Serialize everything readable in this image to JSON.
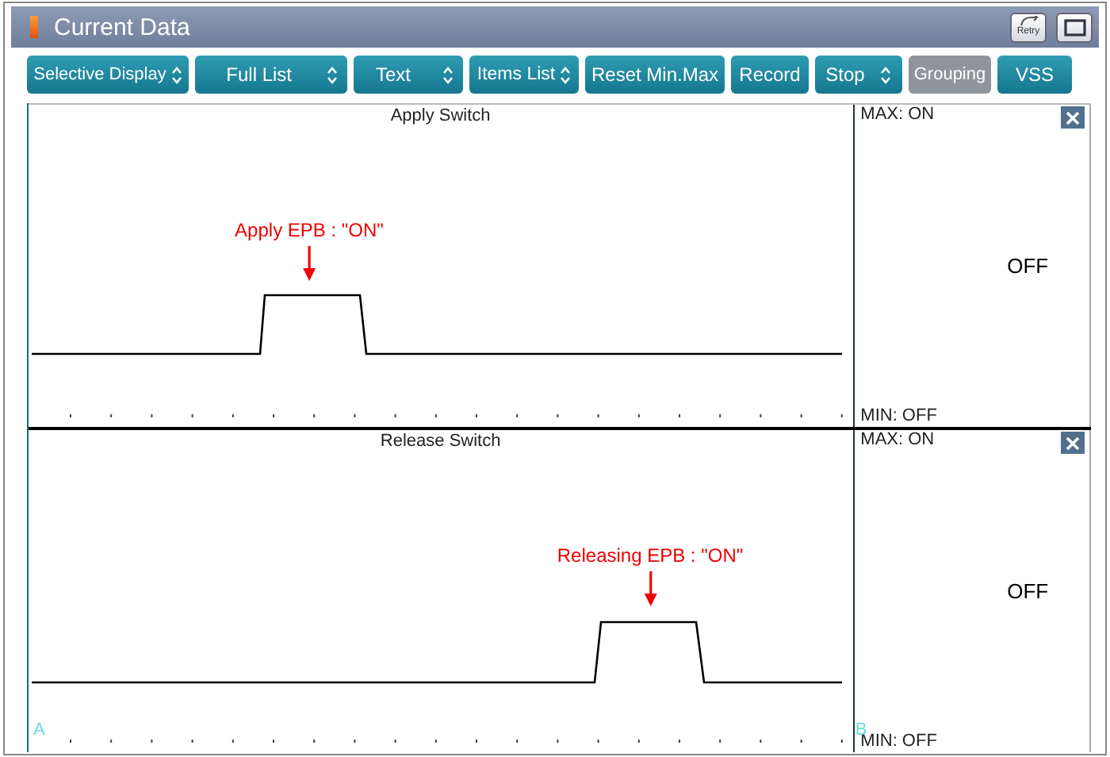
{
  "window": {
    "title": "Current Data",
    "retry_label": "Retry"
  },
  "toolbar": [
    {
      "label": "Selective Display",
      "kind": "dropdown",
      "disabled": false
    },
    {
      "label": "Full List",
      "kind": "dropdown",
      "disabled": false
    },
    {
      "label": "Text",
      "kind": "dropdown",
      "disabled": false
    },
    {
      "label": "Items List",
      "kind": "dropdown",
      "disabled": false
    },
    {
      "label": "Reset Min.Max",
      "kind": "plain",
      "disabled": false
    },
    {
      "label": "Record",
      "kind": "plain",
      "disabled": false
    },
    {
      "label": "Stop",
      "kind": "dropdown",
      "disabled": false
    },
    {
      "label": "Grouping",
      "kind": "plain",
      "disabled": true
    },
    {
      "label": "VSS",
      "kind": "plain",
      "disabled": false
    }
  ],
  "channels": [
    {
      "name": "Apply Switch",
      "max": "MAX: ON",
      "min": "MIN: OFF",
      "value": "OFF",
      "annotation": "Apply EPB : \"ON\""
    },
    {
      "name": "Release Switch",
      "max": "MAX: ON",
      "min": "MIN: OFF",
      "value": "OFF",
      "annotation": "Releasing EPB : \"ON\"",
      "cursor_a": "A",
      "cursor_b": "B"
    }
  ]
}
